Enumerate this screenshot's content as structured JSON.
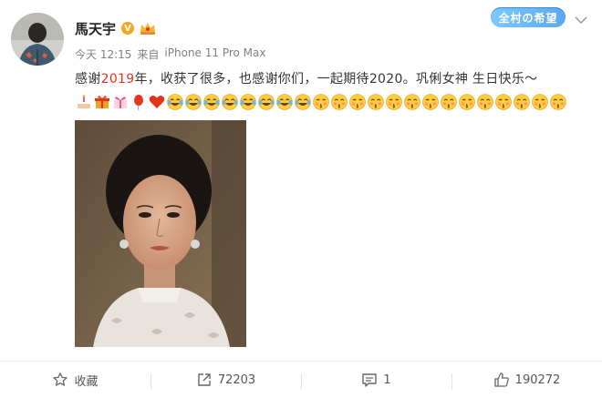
{
  "post": {
    "author": "馬天宇",
    "verified_badge": "V",
    "time": "今天 12:15",
    "source_prefix": "来自",
    "source": "iPhone 11 Pro Max",
    "text_before": "感谢",
    "text_highlight": "2019",
    "text_after": "年，收获了很多，也感谢你们，一起期待2020。巩俐女神 生日快乐～",
    "highlight_color": "#e5341c",
    "emojis": [
      "cake-emoji",
      "gift-emoji",
      "ribbon-gift-emoji",
      "balloon-emoji",
      "heart-emoji",
      "laugh-tears-emoji",
      "laugh-tears-emoji",
      "laugh-tears-emoji",
      "laugh-tears-emoji",
      "laugh-tears-emoji",
      "laugh-tears-emoji",
      "laugh-tears-emoji",
      "laugh-tears-emoji",
      "kiss-emoji",
      "kiss-emoji",
      "kiss-emoji",
      "kiss-emoji",
      "kiss-emoji",
      "kiss-emoji",
      "kiss-emoji",
      "kiss-emoji",
      "kiss-emoji",
      "kiss-emoji",
      "kiss-emoji",
      "kiss-emoji",
      "kiss-emoji",
      "kiss-emoji"
    ]
  },
  "brand_logo_text": "全村の希望",
  "actions": {
    "favorite_label": "收藏",
    "repost_count": "72203",
    "comment_count": "1",
    "like_count": "190272"
  },
  "colors": {
    "accent": "#e5341c",
    "badge": "#f5a623",
    "text": "#333333",
    "muted": "#808080"
  }
}
